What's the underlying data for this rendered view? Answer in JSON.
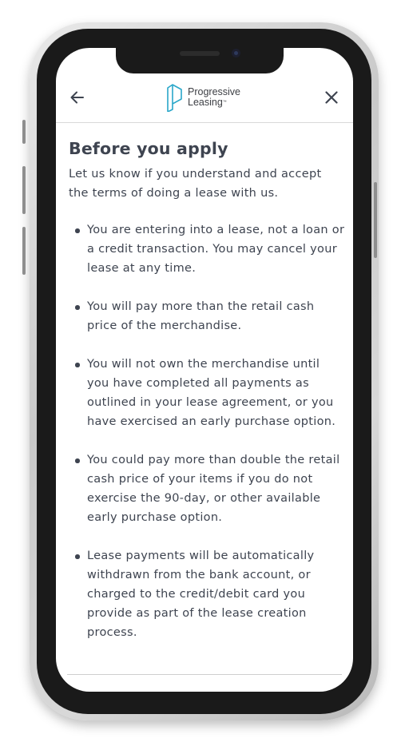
{
  "header": {
    "back_icon": "arrow-left-icon",
    "close_icon": "close-icon",
    "logo": {
      "line1": "Progressive",
      "line2": "Leasing",
      "trademark": "™",
      "accent_color": "#29a7c9"
    }
  },
  "main": {
    "title": "Before you apply",
    "intro": "Let us know if you understand and accept the terms of doing a lease with us.",
    "terms": [
      "You are entering into a lease, not a loan or a credit transaction. You may cancel your lease at any time.",
      "You will pay more than the retail cash price of the merchandise.",
      "You will not own the merchandise until you have completed all payments as outlined in your lease agreement, or you have exercised an early purchase option.",
      "You could pay more than double the retail cash price of your items if you do not exercise the 90-day, or other available early purchase option.",
      "Lease payments will be automatically withdrawn from the bank account, or charged to the credit/debit card you provide as part of the lease creation process."
    ]
  },
  "colors": {
    "text": "#3e4450",
    "divider": "#d9d9d9"
  }
}
